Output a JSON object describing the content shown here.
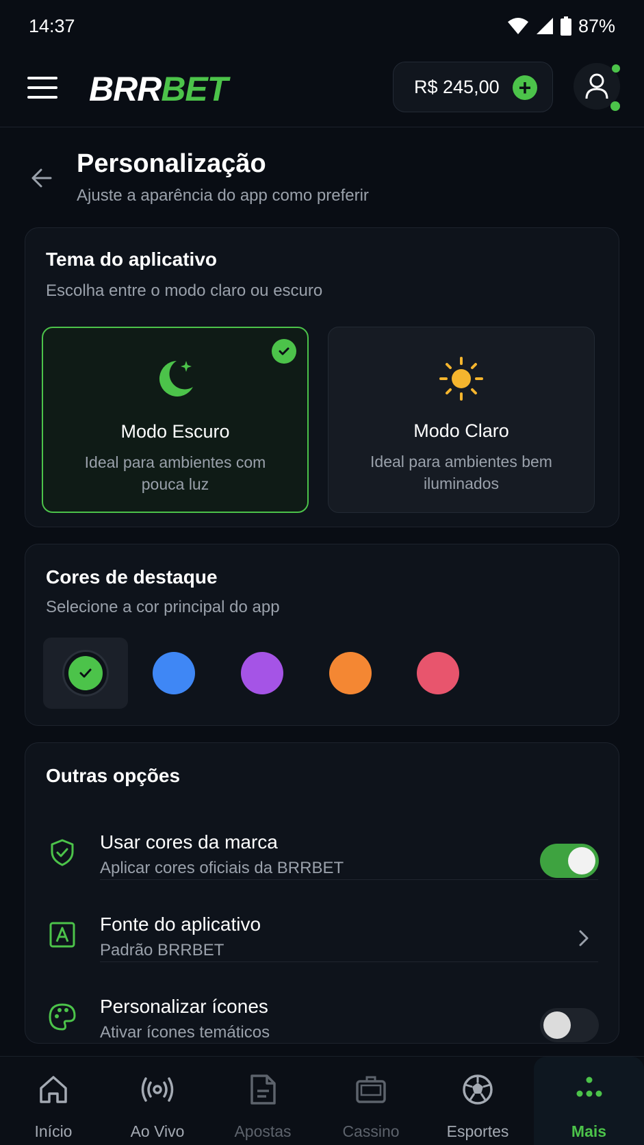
{
  "status_bar": {
    "time": "14:37",
    "battery": "87%"
  },
  "header": {
    "logo_part1": "BRR",
    "logo_part2": "BET",
    "balance": "R$ 245,00",
    "balance_add": "+"
  },
  "page": {
    "title": "Personalização",
    "subtitle": "Ajuste a aparência do app como preferir"
  },
  "theme": {
    "title": "Tema do aplicativo",
    "subtitle": "Escolha entre o modo claro ou escuro",
    "options": [
      {
        "label": "Modo Escuro",
        "desc": "Ideal para ambientes com pouca luz",
        "selected": true
      },
      {
        "label": "Modo Claro",
        "desc": "Ideal para ambientes bem iluminados",
        "selected": false
      }
    ]
  },
  "accent": {
    "title": "Cores de destaque",
    "subtitle": "Selecione a cor principal do app",
    "colors": [
      "#4cc34a",
      "#3f87f5",
      "#a554e6",
      "#f48733",
      "#e8556d"
    ],
    "selected_index": 0
  },
  "other": {
    "title": "Outras opções",
    "rows": [
      {
        "label": "Usar cores da marca",
        "sub": "Aplicar cores oficiais da BRRBET",
        "control": "toggle",
        "on": true
      },
      {
        "label": "Fonte do aplicativo",
        "sub": "Padrão BRRBET",
        "control": "chevron"
      },
      {
        "label": "Personalizar ícones",
        "sub": "Ativar ícones temáticos",
        "control": "toggle",
        "on": false
      }
    ]
  },
  "nav": {
    "items": [
      {
        "label": "Início",
        "icon": "home-icon",
        "color": "#a4aab3"
      },
      {
        "label": "Ao Vivo",
        "icon": "live-icon",
        "color": "#a4aab3"
      },
      {
        "label": "Apostas",
        "icon": "bets-icon",
        "color": "#5d636c"
      },
      {
        "label": "Cassino",
        "icon": "casino-icon",
        "color": "#5d636c"
      },
      {
        "label": "Esportes",
        "icon": "soccer-ball-icon",
        "color": "#a4aab3"
      },
      {
        "label": "Mais",
        "icon": "more-icon",
        "color": "#4cc34a",
        "active": true
      }
    ]
  },
  "colors": {
    "accent": "#4cc34a",
    "background": "#090d14",
    "card": "#0e131b"
  }
}
